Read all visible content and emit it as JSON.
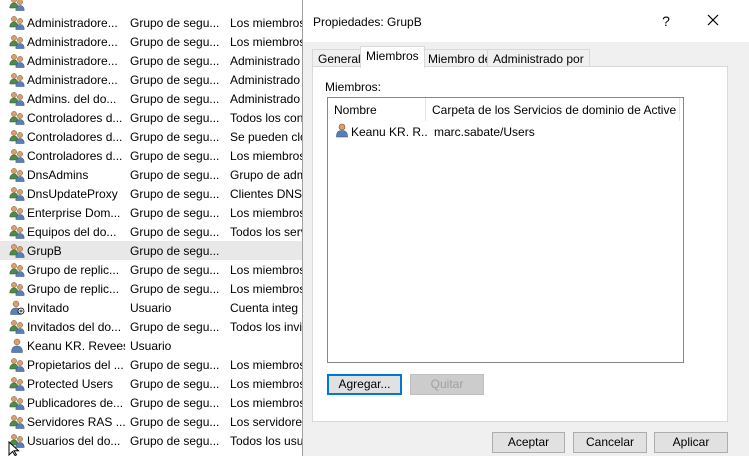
{
  "background_list": {
    "rows": [
      {
        "name": "",
        "type": "",
        "desc": "",
        "icon": "group-icon"
      },
      {
        "name": "Administradore...",
        "type": "Grupo de segu...",
        "desc": "Los miembros",
        "icon": "group-icon"
      },
      {
        "name": "Administradore...",
        "type": "Grupo de segu...",
        "desc": "Los miembros",
        "icon": "group-icon"
      },
      {
        "name": "Administradore...",
        "type": "Grupo de segu...",
        "desc": "Administrado",
        "icon": "group-icon"
      },
      {
        "name": "Administradore...",
        "type": "Grupo de segu...",
        "desc": "Administrado",
        "icon": "group-icon"
      },
      {
        "name": "Admins. del do...",
        "type": "Grupo de segu...",
        "desc": "Administrado",
        "icon": "group-icon"
      },
      {
        "name": "Controladores d...",
        "type": "Grupo de segu...",
        "desc": "Todos los con",
        "icon": "group-icon"
      },
      {
        "name": "Controladores d...",
        "type": "Grupo de segu...",
        "desc": "Se pueden clo",
        "icon": "group-icon"
      },
      {
        "name": "Controladores d...",
        "type": "Grupo de segu...",
        "desc": "Los miembros",
        "icon": "group-icon"
      },
      {
        "name": "DnsAdmins",
        "type": "Grupo de segu...",
        "desc": "Grupo de adm",
        "icon": "group-icon"
      },
      {
        "name": "DnsUpdateProxy",
        "type": "Grupo de segu...",
        "desc": "Clientes DNS",
        "icon": "group-icon"
      },
      {
        "name": "Enterprise Dom...",
        "type": "Grupo de segu...",
        "desc": "Los miembros",
        "icon": "group-icon"
      },
      {
        "name": "Equipos del do...",
        "type": "Grupo de segu...",
        "desc": "Todos los serv",
        "icon": "group-icon"
      },
      {
        "name": "GrupB",
        "type": "Grupo de segu...",
        "desc": "",
        "icon": "group-icon",
        "selected": true
      },
      {
        "name": "Grupo de replic...",
        "type": "Grupo de segu...",
        "desc": "Los miembros",
        "icon": "group-icon"
      },
      {
        "name": "Grupo de replic...",
        "type": "Grupo de segu...",
        "desc": "Los miembros",
        "icon": "group-icon"
      },
      {
        "name": "Invitado",
        "type": "Usuario",
        "desc": "Cuenta integ",
        "icon": "disabled-user-icon"
      },
      {
        "name": "Invitados del do...",
        "type": "Grupo de segu...",
        "desc": "Todos los invit",
        "icon": "group-icon"
      },
      {
        "name": "Keanu KR. Revees",
        "type": "Usuario",
        "desc": "",
        "icon": "user-icon"
      },
      {
        "name": "Propietarios del ...",
        "type": "Grupo de segu...",
        "desc": "Los miembros",
        "icon": "group-icon"
      },
      {
        "name": "Protected Users",
        "type": "Grupo de segu...",
        "desc": "Los miembros",
        "icon": "group-icon"
      },
      {
        "name": "Publicadores de...",
        "type": "Grupo de segu...",
        "desc": "Los miembros",
        "icon": "group-icon"
      },
      {
        "name": "Servidores RAS ...",
        "type": "Grupo de segu...",
        "desc": "Los servidores",
        "icon": "group-icon"
      },
      {
        "name": "Usuarios del do...",
        "type": "Grupo de segu...",
        "desc": "Todos los usu",
        "icon": "group-icon"
      }
    ]
  },
  "dialog": {
    "title": "Propiedades: GrupB",
    "help": "?",
    "tabs": [
      {
        "label": "General"
      },
      {
        "label": "Miembros",
        "active": true
      },
      {
        "label": "Miembro de"
      },
      {
        "label": "Administrado por"
      }
    ],
    "members_label": "Miembros:",
    "columns": {
      "name": "Nombre",
      "folder": "Carpeta de los Servicios de dominio de Active Dir..."
    },
    "members": [
      {
        "name": "Keanu KR. R...",
        "folder": "marc.sabate/Users",
        "icon": "user-icon"
      }
    ],
    "add_label": "Agregar...",
    "remove_label": "Quitar",
    "ok_label": "Aceptar",
    "cancel_label": "Cancelar",
    "apply_label": "Aplicar"
  }
}
